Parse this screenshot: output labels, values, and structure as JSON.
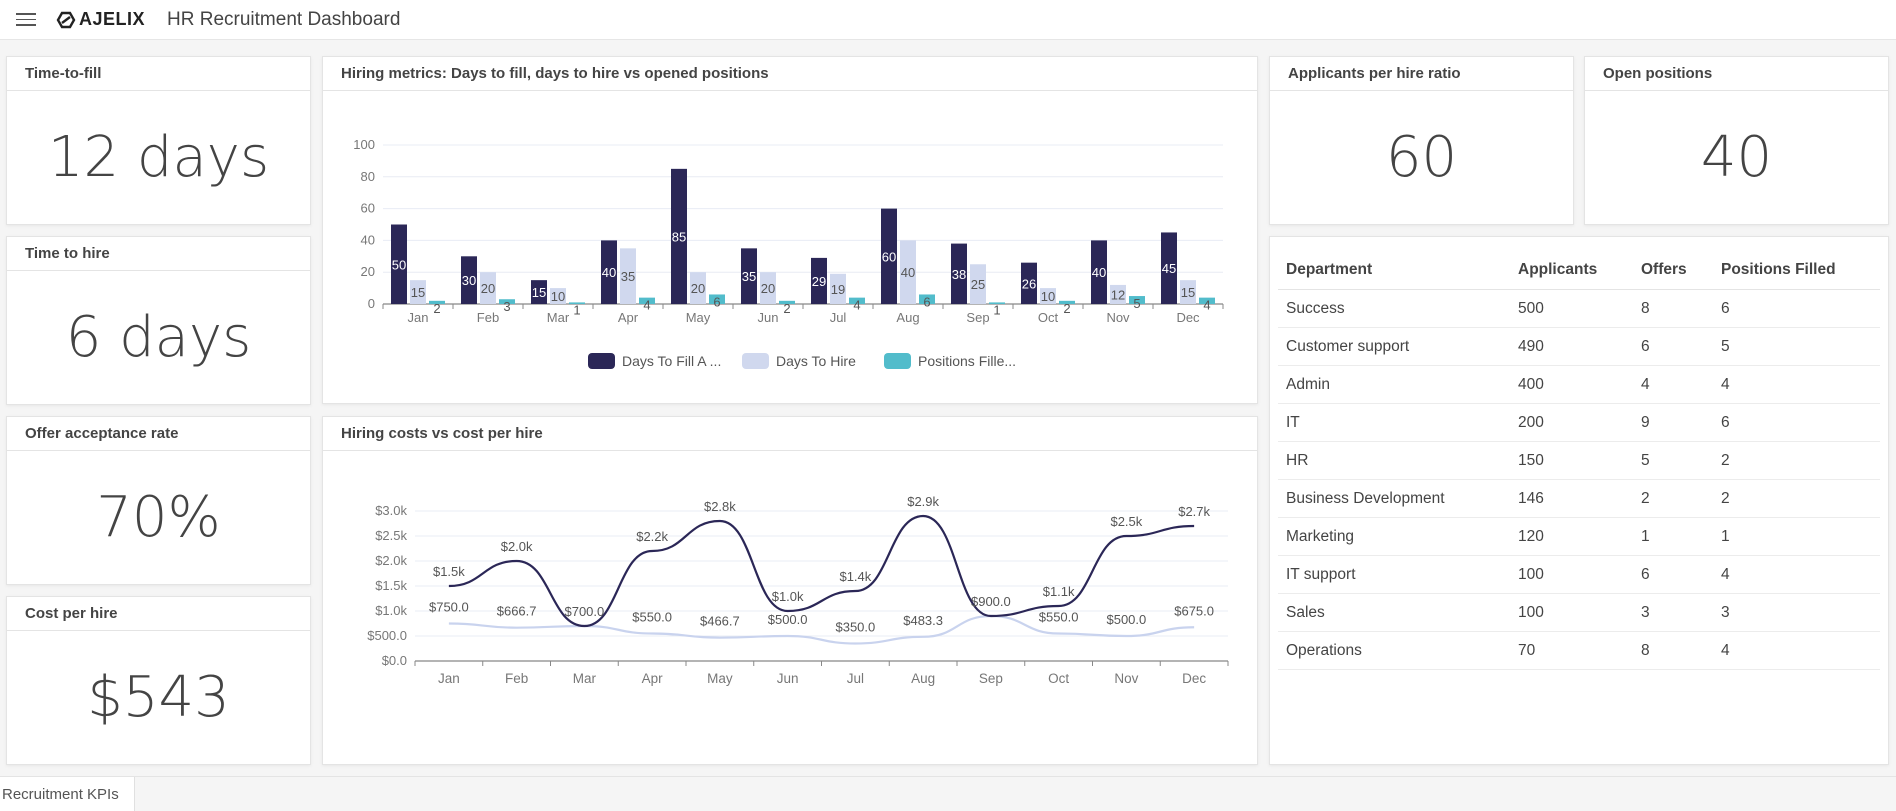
{
  "app": {
    "title": "HR Recruitment Dashboard",
    "logo_text": "AJELIX",
    "menu_icon": "hamburger-menu-icon"
  },
  "kpis": {
    "time_to_fill": {
      "label": "Time-to-fill",
      "value": "12 days"
    },
    "time_to_hire": {
      "label": "Time to hire",
      "value": "6 days"
    },
    "offer_acceptance": {
      "label": "Offer acceptance rate",
      "value": "70%"
    },
    "cost_per_hire": {
      "label": "Cost per hire",
      "value": "$543"
    },
    "applicants_per_hire": {
      "label": "Applicants per hire ratio",
      "value": "60"
    },
    "open_positions": {
      "label": "Open positions",
      "value": "40"
    }
  },
  "colors": {
    "dark_navy": "#2b2757",
    "light_lavender": "#d0d8ee",
    "teal": "#52bccb",
    "grid": "#e8ecf4"
  },
  "chart_data": [
    {
      "type": "bar",
      "title": "Hiring metrics: Days to fill, days to hire vs opened positions",
      "categories": [
        "Jan",
        "Feb",
        "Mar",
        "Apr",
        "May",
        "Jun",
        "Jul",
        "Aug",
        "Sep",
        "Oct",
        "Nov",
        "Dec"
      ],
      "series": [
        {
          "name": "Days To Fill A ...",
          "color": "#2b2757",
          "values": [
            50,
            30,
            15,
            40,
            85,
            35,
            29,
            60,
            38,
            26,
            40,
            45
          ]
        },
        {
          "name": "Days To Hire",
          "color": "#d0d8ee",
          "values": [
            15,
            20,
            10,
            35,
            20,
            20,
            19,
            40,
            25,
            10,
            12,
            15
          ]
        },
        {
          "name": "Positions Fille...",
          "color": "#52bccb",
          "values": [
            2,
            3,
            1,
            4,
            6,
            2,
            4,
            6,
            1,
            2,
            5,
            4
          ]
        }
      ],
      "yticks": [
        "0",
        "20",
        "40",
        "60",
        "80",
        "100"
      ],
      "ylim": [
        0,
        100
      ],
      "grid": true,
      "legend": "bottom",
      "xlabel": "",
      "ylabel": ""
    },
    {
      "type": "line",
      "title": "Hiring costs vs cost per hire",
      "categories": [
        "Jan",
        "Feb",
        "Mar",
        "Apr",
        "May",
        "Jun",
        "Jul",
        "Aug",
        "Sep",
        "Oct",
        "Nov",
        "Dec"
      ],
      "series": [
        {
          "name": "Hiring costs",
          "color": "#2b2757",
          "values": [
            1500,
            2000,
            700,
            2200,
            2800,
            1000,
            1400,
            2900,
            900,
            1100,
            2500,
            2700
          ],
          "labels": [
            "$1.5k",
            "$2.0k",
            "$700.0",
            "$2.2k",
            "$2.8k",
            "$1.0k",
            "$1.4k",
            "$2.9k",
            "$900.0",
            "$1.1k",
            "$2.5k",
            "$2.7k"
          ]
        },
        {
          "name": "Cost per hire",
          "color": "#c9d3ee",
          "values": [
            750,
            666.7,
            700,
            550,
            466.7,
            500,
            350,
            483.3,
            900,
            550,
            500,
            675
          ],
          "labels": [
            "$750.0",
            "$666.7",
            "",
            "$550.0",
            "$466.7",
            "$500.0",
            "$350.0",
            "$483.3",
            "",
            "$550.0",
            "$500.0",
            "$675.0"
          ]
        }
      ],
      "yticks": [
        "$0.0",
        "$500.0",
        "$1.0k",
        "$1.5k",
        "$2.0k",
        "$2.5k",
        "$3.0k"
      ],
      "ylim": [
        0,
        3000
      ],
      "grid": true,
      "legend": "none",
      "xlabel": "",
      "ylabel": ""
    }
  ],
  "table": {
    "headers": [
      "Department",
      "Applicants",
      "Offers",
      "Positions Filled"
    ],
    "rows": [
      [
        "Success",
        "500",
        "8",
        "6"
      ],
      [
        "Customer support",
        "490",
        "6",
        "5"
      ],
      [
        "Admin",
        "400",
        "4",
        "4"
      ],
      [
        "IT",
        "200",
        "9",
        "6"
      ],
      [
        "HR",
        "150",
        "5",
        "2"
      ],
      [
        "Business Development",
        "146",
        "2",
        "2"
      ],
      [
        "Marketing",
        "120",
        "1",
        "1"
      ],
      [
        "IT support",
        "100",
        "6",
        "4"
      ],
      [
        "Sales",
        "100",
        "3",
        "3"
      ],
      [
        "Operations",
        "70",
        "8",
        "4"
      ]
    ]
  },
  "sheet_tabs": [
    {
      "label": "Recruitment KPIs"
    }
  ]
}
